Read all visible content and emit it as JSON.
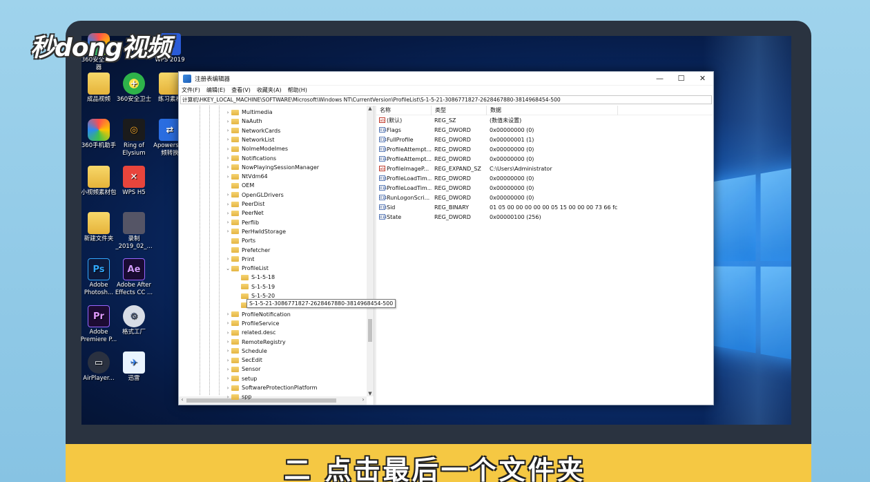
{
  "watermark": "秒dong视频",
  "caption": "二 点击最后一个文件夹",
  "desktop_icons": [
    {
      "label": "360安全浏览器",
      "icon": "browser-360-icon"
    },
    {
      "label": "WPS 2019",
      "icon": "wps-icon"
    },
    {
      "label": "成品视频",
      "icon": "folder-icon"
    },
    {
      "label": "360安全卫士",
      "icon": "security-360-icon"
    },
    {
      "label": "练习素材",
      "icon": "folder-icon"
    },
    {
      "label": "360手机助手",
      "icon": "mobile-360-icon"
    },
    {
      "label": "Ring of Elysium",
      "icon": "ring-of-elysium-icon"
    },
    {
      "label": "Apowers 视频转换",
      "icon": "apowersoft-icon"
    },
    {
      "label": "小视频素材包",
      "icon": "folder-icon"
    },
    {
      "label": "WPS H5",
      "icon": "wps-h5-icon"
    },
    {
      "label": "新建文件夹",
      "icon": "folder-icon"
    },
    {
      "label": "录制 _2019_02_...",
      "icon": "video-file-icon"
    },
    {
      "label": "Adobe Photosh...",
      "icon": "photoshop-icon"
    },
    {
      "label": "Adobe After Effects CC ...",
      "icon": "after-effects-icon"
    },
    {
      "label": "Adobe Premiere P...",
      "icon": "premiere-icon"
    },
    {
      "label": "格式工厂",
      "icon": "format-factory-icon"
    },
    {
      "label": "AirPlayer...",
      "icon": "airplayer-icon"
    },
    {
      "label": "迅雷",
      "icon": "xunlei-icon"
    }
  ],
  "regedit": {
    "title": "注册表编辑器",
    "minimize": "—",
    "maximize": "☐",
    "close": "✕",
    "menu": [
      "文件(F)",
      "编辑(E)",
      "查看(V)",
      "收藏夹(A)",
      "帮助(H)"
    ],
    "address": "计算机\\HKEY_LOCAL_MACHINE\\SOFTWARE\\Microsoft\\Windows NT\\CurrentVersion\\ProfileList\\S-1-5-21-3086771827-2628467880-3814968454-500",
    "tree": [
      {
        "label": "Multimedia",
        "depth": 0,
        "arrow": "›"
      },
      {
        "label": "NaAuth",
        "depth": 0,
        "arrow": "›"
      },
      {
        "label": "NetworkCards",
        "depth": 0,
        "arrow": "›"
      },
      {
        "label": "NetworkList",
        "depth": 0,
        "arrow": "›"
      },
      {
        "label": "NoImeModeImes",
        "depth": 0,
        "arrow": "›"
      },
      {
        "label": "Notifications",
        "depth": 0,
        "arrow": "›"
      },
      {
        "label": "NowPlayingSessionManager",
        "depth": 0,
        "arrow": "›"
      },
      {
        "label": "NtVdm64",
        "depth": 0,
        "arrow": "›"
      },
      {
        "label": "OEM",
        "depth": 0,
        "arrow": ""
      },
      {
        "label": "OpenGLDrivers",
        "depth": 0,
        "arrow": "›"
      },
      {
        "label": "PeerDist",
        "depth": 0,
        "arrow": "›"
      },
      {
        "label": "PeerNet",
        "depth": 0,
        "arrow": "›"
      },
      {
        "label": "Perflib",
        "depth": 0,
        "arrow": "›"
      },
      {
        "label": "PerHwIdStorage",
        "depth": 0,
        "arrow": "›"
      },
      {
        "label": "Ports",
        "depth": 0,
        "arrow": ""
      },
      {
        "label": "Prefetcher",
        "depth": 0,
        "arrow": ""
      },
      {
        "label": "Print",
        "depth": 0,
        "arrow": "›"
      },
      {
        "label": "ProfileList",
        "depth": 0,
        "arrow": "⌄"
      },
      {
        "label": "S-1-5-18",
        "depth": 1,
        "arrow": ""
      },
      {
        "label": "S-1-5-19",
        "depth": 1,
        "arrow": ""
      },
      {
        "label": "S-1-5-20",
        "depth": 1,
        "arrow": ""
      },
      {
        "label": "",
        "depth": 1,
        "arrow": ""
      },
      {
        "label": "ProfileNotification",
        "depth": 0,
        "arrow": "›"
      },
      {
        "label": "ProfileService",
        "depth": 0,
        "arrow": "›"
      },
      {
        "label": "related.desc",
        "depth": 0,
        "arrow": "›"
      },
      {
        "label": "RemoteRegistry",
        "depth": 0,
        "arrow": "›"
      },
      {
        "label": "Schedule",
        "depth": 0,
        "arrow": "›"
      },
      {
        "label": "SecEdit",
        "depth": 0,
        "arrow": "›"
      },
      {
        "label": "Sensor",
        "depth": 0,
        "arrow": "›"
      },
      {
        "label": "setup",
        "depth": 0,
        "arrow": "›"
      },
      {
        "label": "SoftwareProtectionPlatform",
        "depth": 0,
        "arrow": "›"
      },
      {
        "label": "spp",
        "depth": 0,
        "arrow": "›"
      }
    ],
    "tooltip": "S-1-5-21-3086771827-2628467880-3814968454-500",
    "columns": [
      "名称",
      "类型",
      "数据"
    ],
    "values": [
      {
        "name": "(默认)",
        "type": "REG_SZ",
        "data": "(数值未设置)",
        "kind": "ab"
      },
      {
        "name": "Flags",
        "type": "REG_DWORD",
        "data": "0x00000000 (0)",
        "kind": "bin"
      },
      {
        "name": "FullProfile",
        "type": "REG_DWORD",
        "data": "0x00000001 (1)",
        "kind": "bin"
      },
      {
        "name": "ProfileAttempt...",
        "type": "REG_DWORD",
        "data": "0x00000000 (0)",
        "kind": "bin"
      },
      {
        "name": "ProfileAttempt...",
        "type": "REG_DWORD",
        "data": "0x00000000 (0)",
        "kind": "bin"
      },
      {
        "name": "ProfileImageP...",
        "type": "REG_EXPAND_SZ",
        "data": "C:\\Users\\Administrator",
        "kind": "ab"
      },
      {
        "name": "ProfileLoadTim...",
        "type": "REG_DWORD",
        "data": "0x00000000 (0)",
        "kind": "bin"
      },
      {
        "name": "ProfileLoadTim...",
        "type": "REG_DWORD",
        "data": "0x00000000 (0)",
        "kind": "bin"
      },
      {
        "name": "RunLogonScri...",
        "type": "REG_DWORD",
        "data": "0x00000000 (0)",
        "kind": "bin"
      },
      {
        "name": "Sid",
        "type": "REG_BINARY",
        "data": "01 05 00 00 00 00 00 05 15 00 00 00 73 66 fc ...",
        "kind": "bin"
      },
      {
        "name": "State",
        "type": "REG_DWORD",
        "data": "0x00000100 (256)",
        "kind": "bin"
      }
    ]
  },
  "colors": {
    "caption_strip": "#f5c843",
    "folder": "#f5d372",
    "desktop": "#0a2d6c"
  }
}
